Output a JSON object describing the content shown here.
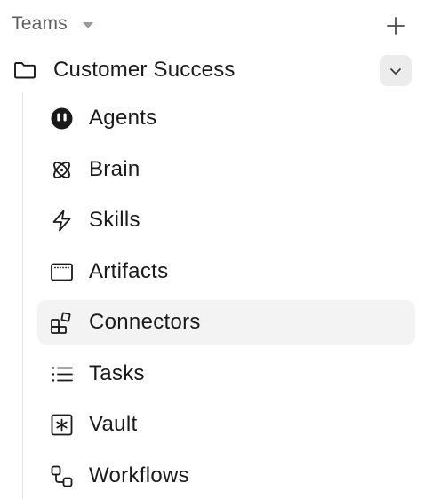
{
  "header": {
    "title": "Teams",
    "caret_icon": "caret-down-icon",
    "add_icon": "plus-icon"
  },
  "team": {
    "name": "Customer Success",
    "icon": "folder-icon",
    "toggle_icon": "chevron-down-icon",
    "expanded": true
  },
  "nav": {
    "selected": "Connectors",
    "items": [
      {
        "label": "Agents",
        "icon": "agent-face-icon"
      },
      {
        "label": "Brain",
        "icon": "atom-icon"
      },
      {
        "label": "Skills",
        "icon": "lightning-icon"
      },
      {
        "label": "Artifacts",
        "icon": "window-icon"
      },
      {
        "label": "Connectors",
        "icon": "blocks-icon"
      },
      {
        "label": "Tasks",
        "icon": "list-icon"
      },
      {
        "label": "Vault",
        "icon": "asterisk-box-icon"
      },
      {
        "label": "Workflows",
        "icon": "workflow-icon"
      }
    ]
  },
  "colors": {
    "text": "#1a1a1a",
    "muted_text": "#5f5f5f",
    "selected_bg": "#f3f3f3",
    "toggle_bg": "#ececec",
    "tree_line": "#e4e4e4"
  }
}
